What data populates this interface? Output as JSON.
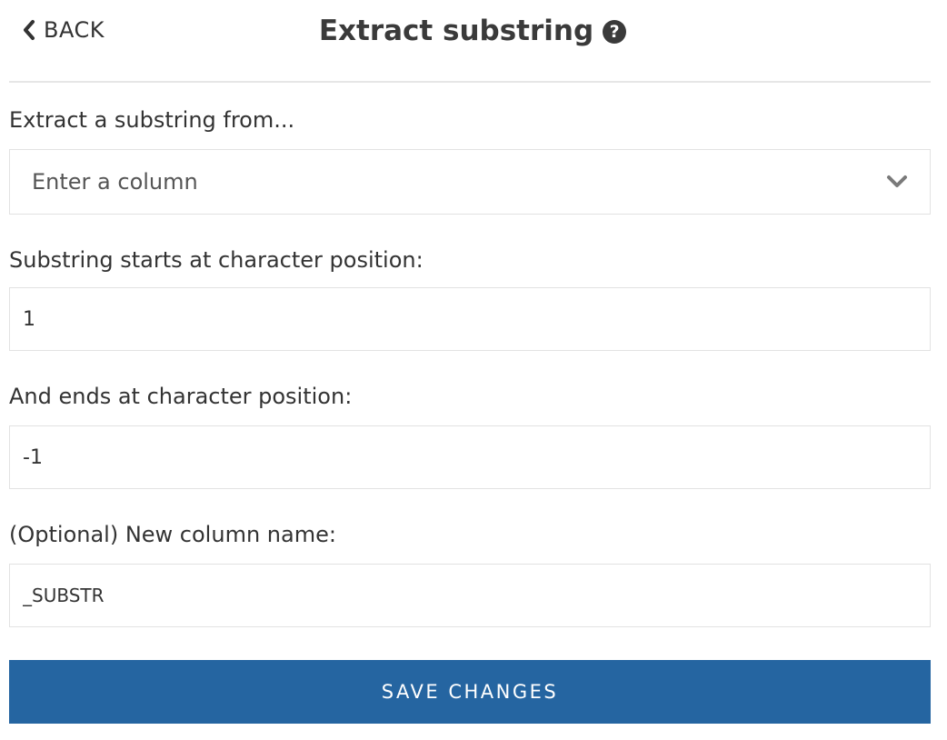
{
  "header": {
    "back_label": "BACK",
    "title": "Extract substring",
    "help_glyph": "?"
  },
  "form": {
    "column": {
      "label": "Extract a substring from...",
      "selected_value": "Enter a column"
    },
    "start_position": {
      "label": "Substring starts at character position:",
      "value": "1"
    },
    "end_position": {
      "label": "And ends at character position:",
      "value": "-1"
    },
    "new_column_name": {
      "label": "(Optional) New column name:",
      "value": "_SUBSTR"
    }
  },
  "actions": {
    "save_label": "SAVE CHANGES"
  },
  "colors": {
    "primary_button": "#2565a1",
    "text": "#333333",
    "border": "#e2e2e2"
  }
}
